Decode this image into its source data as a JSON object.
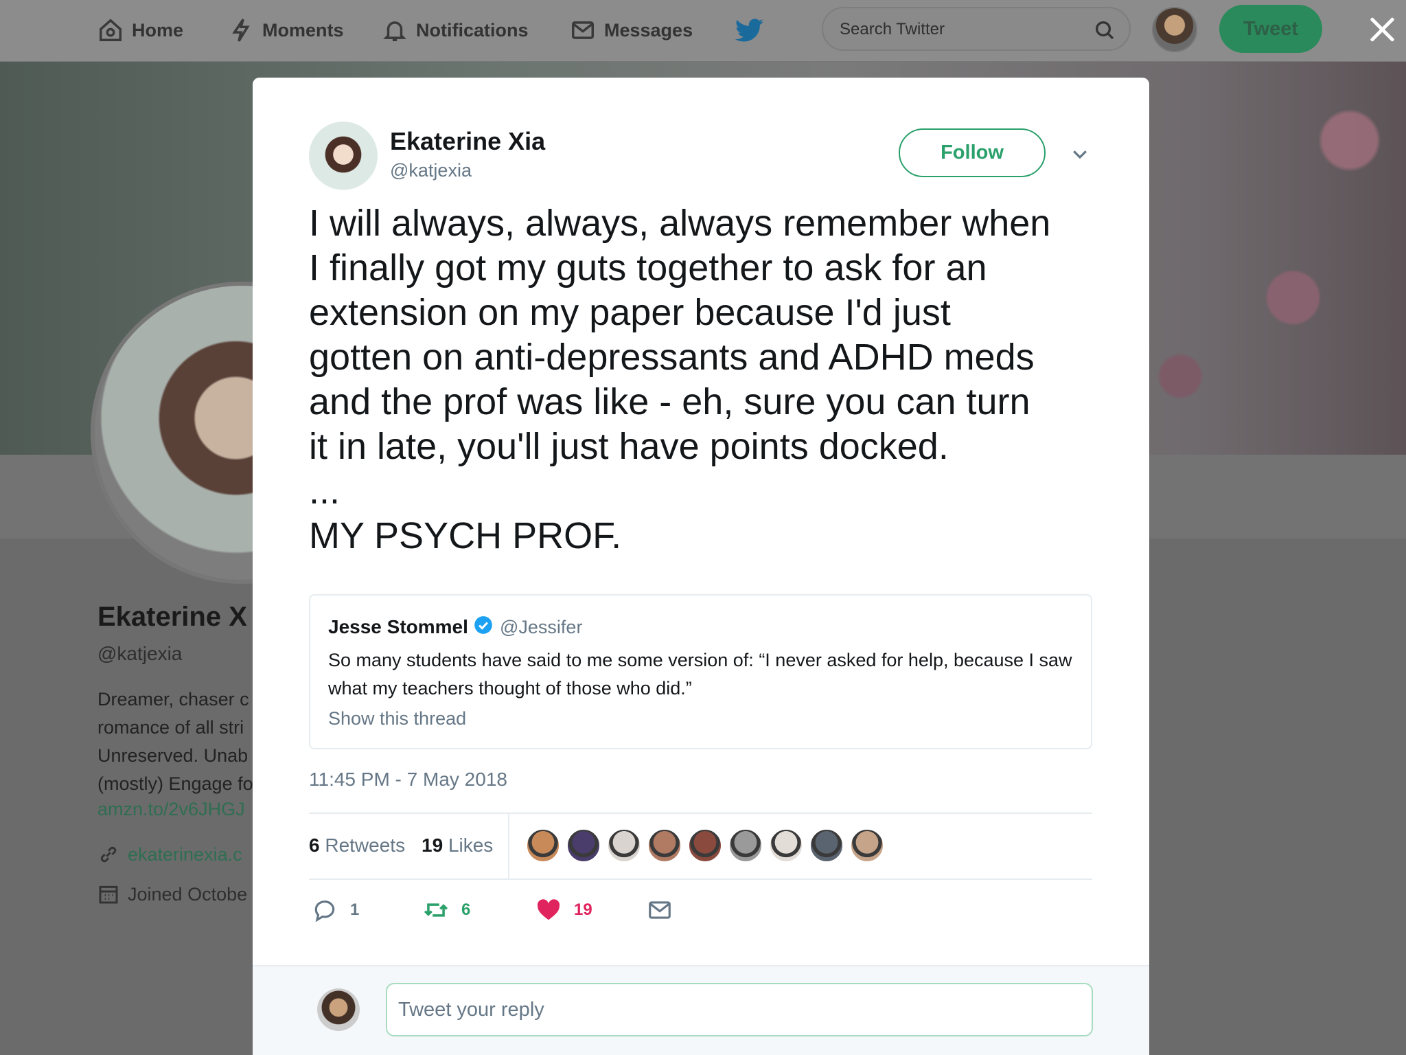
{
  "nav": {
    "home": "Home",
    "moments": "Moments",
    "notifications": "Notifications",
    "messages": "Messages",
    "search_placeholder": "Search Twitter",
    "tweet_button": "Tweet"
  },
  "background_profile": {
    "name": "Ekaterine X",
    "handle": "@katjexia",
    "bio": "Dreamer, chaser c romance of all stri Unreserved. Unab (mostly) Engage fo",
    "bio_link": "amzn.to/2v6JHGJ",
    "website": "ekaterinexia.c",
    "joined": "Joined Octobe"
  },
  "tweet": {
    "author_name": "Ekaterine Xia",
    "author_handle": "@katjexia",
    "follow_label": "Follow",
    "text": "I will always, always, always remember when\nI finally got my guts together to ask for an\nextension on my paper because I'd just\ngotten on anti-depressants and ADHD meds\nand the prof was like - eh, sure you can turn\nit in late, you'll just have points docked.\n...\nMY PSYCH PROF.",
    "quoted": {
      "name": "Jesse Stommel",
      "handle": "@Jessifer",
      "text": "So many students have said to me some version of: “I never asked for help, because I saw what my teachers thought of those who did.”",
      "thread_link": "Show this thread"
    },
    "timestamp": "11:45 PM - 7 May 2018",
    "retweets_count": "6",
    "retweets_label": "Retweets",
    "likes_count": "19",
    "likes_label": "Likes",
    "actions": {
      "reply_count": "1",
      "retweet_count": "6",
      "like_count": "19"
    }
  },
  "liker_colors": [
    "#c98a5a",
    "#4b3d6b",
    "#d9d4cf",
    "#b07a63",
    "#8a4a3e",
    "#9a9a9a",
    "#e3ddd8",
    "#5a6470",
    "#c6a48a"
  ],
  "reply": {
    "placeholder": "Tweet your reply"
  },
  "colors": {
    "accent_green": "#2aa06a",
    "like_red": "#e0245e",
    "verified_blue": "#1da1f2"
  }
}
